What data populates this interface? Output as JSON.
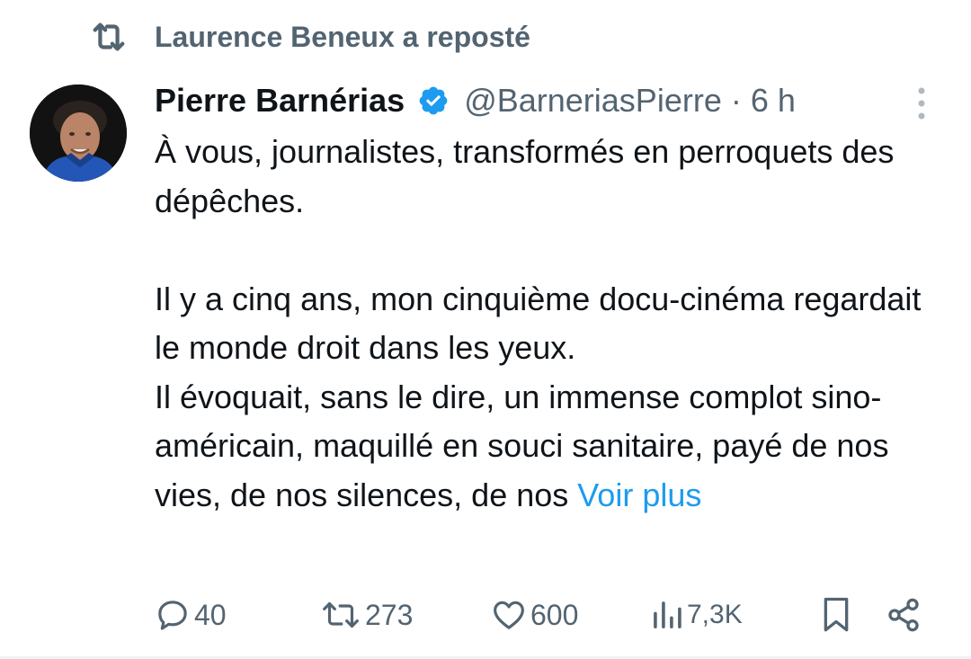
{
  "repost": {
    "icon": "repost-icon",
    "label": "Laurence Beneux a reposté"
  },
  "author": {
    "avatar": "avatar-photo",
    "display_name": "Pierre Barnérias",
    "verified_icon": "verified-badge-icon",
    "handle": "@BarneriasPierre",
    "separator": "·",
    "timestamp": "6 h"
  },
  "menu": {
    "icon": "more-vertical-icon"
  },
  "tweet": {
    "line1": "À vous, journalistes, transformés en perroquets des dépêches.",
    "line2": "Il y a cinq ans, mon cinquième docu-cinéma regardait le monde droit dans les yeux.",
    "line3": "Il évoquait, sans le dire, un immense complot sino-américain, maquillé en souci sanitaire, payé de nos vies, de nos silences, de nos",
    "more_link": "Voir plus"
  },
  "actions": {
    "reply": {
      "icon": "reply-icon",
      "count": "40"
    },
    "repost": {
      "icon": "repost-icon",
      "count": "273"
    },
    "like": {
      "icon": "heart-icon",
      "count": "600"
    },
    "views": {
      "icon": "views-icon",
      "count": "7,3K"
    },
    "bookmark": {
      "icon": "bookmark-icon"
    },
    "share": {
      "icon": "share-icon"
    }
  },
  "colors": {
    "text": "#0f1419",
    "secondary": "#536471",
    "link": "#1d9bf0",
    "verified": "#1d9bf0"
  }
}
